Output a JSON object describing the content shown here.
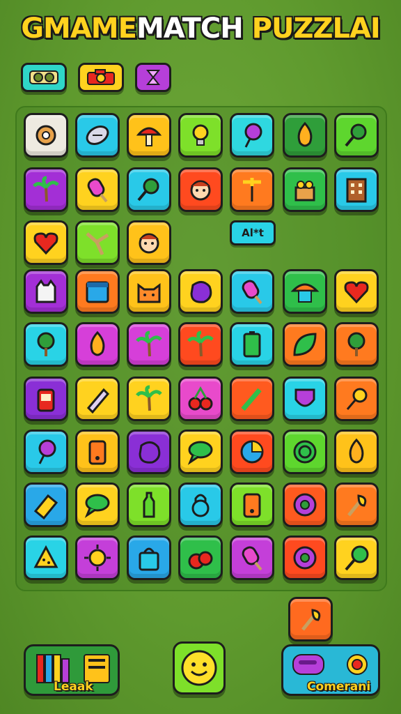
{
  "title": {
    "part1": "GMAME",
    "part2": "MATCH",
    "part3": " PUZZLAI"
  },
  "toolbar": {
    "buttons": [
      {
        "icon": "tape-icon",
        "color": "#2fd6c8"
      },
      {
        "icon": "camera-icon",
        "color": "#ffd21f"
      },
      {
        "icon": "hourglass-icon",
        "color": "#b63fd9"
      }
    ]
  },
  "board": {
    "chip_label": "Al*t",
    "rows": [
      [
        "gear-icon",
        "football-icon",
        "mushroom-icon",
        "lightbulb-icon",
        "balloon-icon",
        "flame-icon",
        "magnifier-icon"
      ],
      [
        "palm-tree-icon",
        "popsicle-icon",
        "magnifier-icon",
        "face-icon",
        "windmill-icon",
        "crate-icon",
        "building-icon"
      ],
      [
        "heart-icon",
        "branch-icon",
        "face-icon",
        null,
        null,
        null,
        null
      ],
      [
        "cat-ghost-icon",
        "calendar-icon",
        "cat-icon",
        "blob-icon",
        "popsicle-icon",
        "hut-icon",
        "heart-icon"
      ],
      [
        "tree-icon",
        "flame-icon",
        "palm-tree-icon",
        "palm-tree-icon",
        "battery-icon",
        "leaf-icon",
        "tree-icon"
      ],
      [
        "jar-icon",
        "pencil-icon",
        "palm-tree-icon",
        "cherries-icon",
        "brush-icon",
        "shield-icon",
        "comet-icon"
      ],
      [
        "balloon-icon",
        "phone-icon",
        "blob-icon",
        "speech-bubble-icon",
        "pie-chart-icon",
        "spiral-icon",
        "flame-icon"
      ],
      [
        "eraser-icon",
        "speech-bubble-icon",
        "bottle-icon",
        "lock-icon",
        "phone-icon",
        "eye-icon",
        "torch-icon"
      ],
      [
        "cheese-icon",
        "sun-icon",
        "bag-icon",
        "apples-icon",
        "popsicle-icon",
        "eye-icon",
        "pin-icon"
      ]
    ],
    "colors": [
      [
        "#eeeae0",
        "#29c9e8",
        "#ffc21a",
        "#7ee02a",
        "#2fd8e0",
        "#2f9e3a",
        "#5ed62e"
      ],
      [
        "#a32fd6",
        "#ffd21f",
        "#29c9e8",
        "#ff4a1f",
        "#ff7a1f",
        "#2fbf4a",
        "#29c9e8"
      ],
      [
        "#ffd21f",
        "#7ee02a",
        "#ffc21a",
        null,
        null,
        null,
        null
      ],
      [
        "#a32fd6",
        "#ff7a1f",
        "#ffc21a",
        "#ffd21f",
        "#29c9e8",
        "#2fbf4a",
        "#ffd21f"
      ],
      [
        "#29d3e6",
        "#d63fd9",
        "#d63fd9",
        "#ff4a1f",
        "#29d3e6",
        "#ff7a1f",
        "#ff7a1f"
      ],
      [
        "#8a2fd6",
        "#ffd21f",
        "#ffd21f",
        "#e84acb",
        "#ff5a1f",
        "#29d3e6",
        "#ff7a1f"
      ],
      [
        "#29c9e8",
        "#ffc21a",
        "#8a2fd6",
        "#ffd21f",
        "#ff4a1f",
        "#5ed62e",
        "#ffc21a"
      ],
      [
        "#29a8e8",
        "#ffd21f",
        "#7ee02a",
        "#29c9e8",
        "#7ee02a",
        "#ff5a1f",
        "#ff7a1f"
      ],
      [
        "#29d3e6",
        "#c43fd9",
        "#29a8e8",
        "#2fbf4a",
        "#c43fd9",
        "#ff4a1f",
        "#ffd21f"
      ]
    ]
  },
  "extra_tile": {
    "icon": "torch-icon",
    "color": "#ff6a1f"
  },
  "bottom": {
    "left_label": "Leaak",
    "center_icon": "smiley-icon",
    "right_label": "Comerani"
  }
}
